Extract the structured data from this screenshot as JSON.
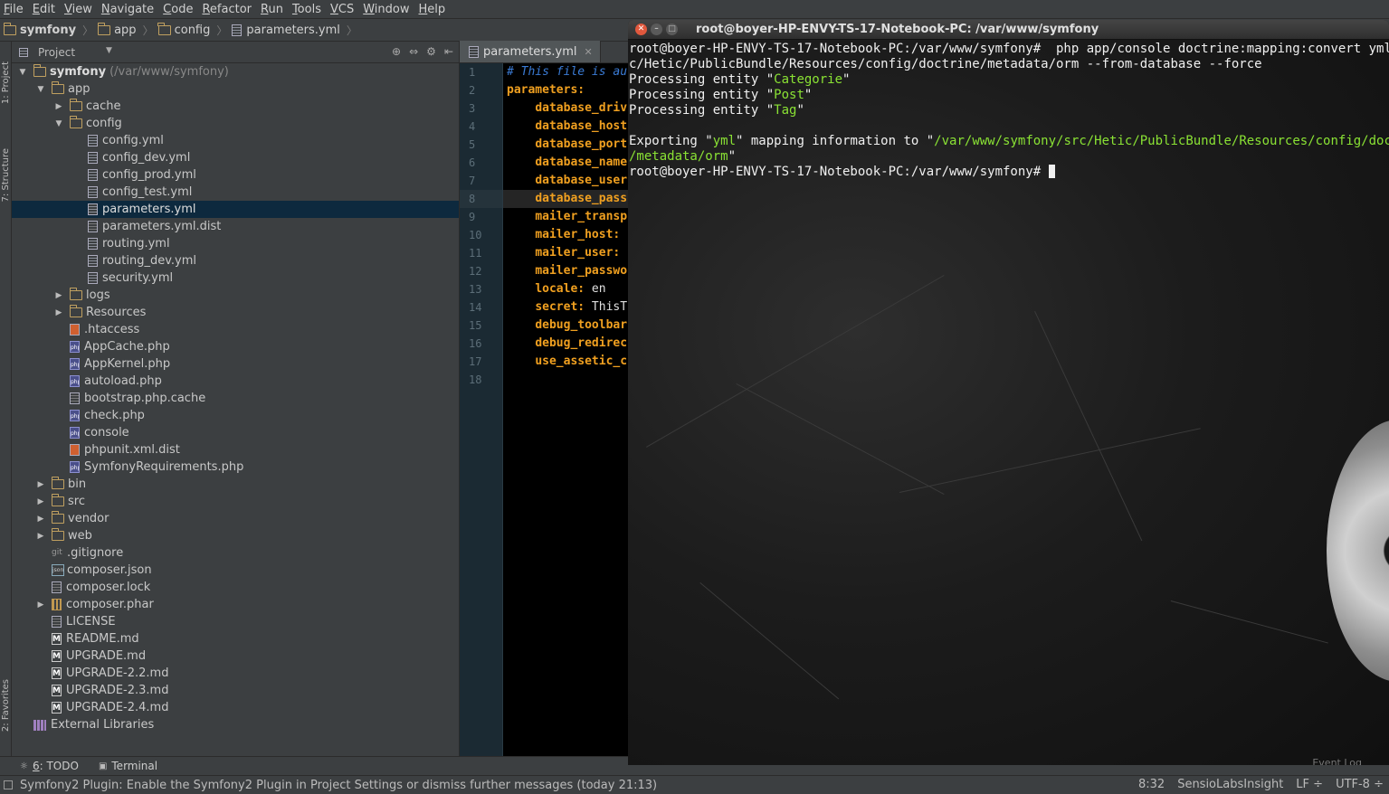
{
  "menu": [
    "File",
    "Edit",
    "View",
    "Navigate",
    "Code",
    "Refactor",
    "Run",
    "Tools",
    "VCS",
    "Window",
    "Help"
  ],
  "breadcrumb": [
    "symfony",
    "app",
    "config",
    "parameters.yml"
  ],
  "left_strip": {
    "project": "1: Project",
    "structure": "7: Structure",
    "favorites": "2: Favorites"
  },
  "project_panel": {
    "title": "Project",
    "tree": [
      {
        "label": "symfony",
        "note": "(/var/www/symfony)",
        "depth": 0,
        "type": "folder",
        "arrow": "▼",
        "bold": true
      },
      {
        "label": "app",
        "depth": 1,
        "type": "folder",
        "arrow": "▼"
      },
      {
        "label": "cache",
        "depth": 2,
        "type": "folder",
        "arrow": "▶"
      },
      {
        "label": "config",
        "depth": 2,
        "type": "folder",
        "arrow": "▼"
      },
      {
        "label": "config.yml",
        "depth": 3,
        "type": "yml"
      },
      {
        "label": "config_dev.yml",
        "depth": 3,
        "type": "yml"
      },
      {
        "label": "config_prod.yml",
        "depth": 3,
        "type": "yml"
      },
      {
        "label": "config_test.yml",
        "depth": 3,
        "type": "yml"
      },
      {
        "label": "parameters.yml",
        "depth": 3,
        "type": "yml",
        "selected": true
      },
      {
        "label": "parameters.yml.dist",
        "depth": 3,
        "type": "txt"
      },
      {
        "label": "routing.yml",
        "depth": 3,
        "type": "yml"
      },
      {
        "label": "routing_dev.yml",
        "depth": 3,
        "type": "yml"
      },
      {
        "label": "security.yml",
        "depth": 3,
        "type": "yml"
      },
      {
        "label": "logs",
        "depth": 2,
        "type": "folder",
        "arrow": "▶"
      },
      {
        "label": "Resources",
        "depth": 2,
        "type": "folder",
        "arrow": "▶"
      },
      {
        "label": ".htaccess",
        "depth": 2,
        "type": "ht"
      },
      {
        "label": "AppCache.php",
        "depth": 2,
        "type": "php"
      },
      {
        "label": "AppKernel.php",
        "depth": 2,
        "type": "php"
      },
      {
        "label": "autoload.php",
        "depth": 2,
        "type": "php"
      },
      {
        "label": "bootstrap.php.cache",
        "depth": 2,
        "type": "txt"
      },
      {
        "label": "check.php",
        "depth": 2,
        "type": "php"
      },
      {
        "label": "console",
        "depth": 2,
        "type": "php"
      },
      {
        "label": "phpunit.xml.dist",
        "depth": 2,
        "type": "ht"
      },
      {
        "label": "SymfonyRequirements.php",
        "depth": 2,
        "type": "php"
      },
      {
        "label": "bin",
        "depth": 1,
        "type": "folder",
        "arrow": "▶"
      },
      {
        "label": "src",
        "depth": 1,
        "type": "folder",
        "arrow": "▶"
      },
      {
        "label": "vendor",
        "depth": 1,
        "type": "folder",
        "arrow": "▶"
      },
      {
        "label": "web",
        "depth": 1,
        "type": "folder",
        "arrow": "▶"
      },
      {
        "label": ".gitignore",
        "depth": 1,
        "type": "git"
      },
      {
        "label": "composer.json",
        "depth": 1,
        "type": "json"
      },
      {
        "label": "composer.lock",
        "depth": 1,
        "type": "txt"
      },
      {
        "label": "composer.phar",
        "depth": 1,
        "type": "phar",
        "arrow": "▶"
      },
      {
        "label": "LICENSE",
        "depth": 1,
        "type": "txt"
      },
      {
        "label": "README.md",
        "depth": 1,
        "type": "md"
      },
      {
        "label": "UPGRADE.md",
        "depth": 1,
        "type": "md"
      },
      {
        "label": "UPGRADE-2.2.md",
        "depth": 1,
        "type": "md"
      },
      {
        "label": "UPGRADE-2.3.md",
        "depth": 1,
        "type": "md"
      },
      {
        "label": "UPGRADE-2.4.md",
        "depth": 1,
        "type": "md"
      },
      {
        "label": "External Libraries",
        "depth": 0,
        "type": "lib"
      }
    ]
  },
  "editor": {
    "tab": "parameters.yml",
    "current_line": 8,
    "lines": [
      {
        "n": "1",
        "parts": [
          {
            "c": "cm",
            "t": "# This file is au"
          }
        ]
      },
      {
        "n": "2",
        "parts": [
          {
            "c": "ky",
            "t": "parameters:"
          }
        ]
      },
      {
        "n": "3",
        "parts": [
          {
            "c": "vl",
            "t": "    "
          },
          {
            "c": "ky",
            "t": "database_driv"
          }
        ]
      },
      {
        "n": "4",
        "parts": [
          {
            "c": "vl",
            "t": "    "
          },
          {
            "c": "ky",
            "t": "database_host"
          }
        ]
      },
      {
        "n": "5",
        "parts": [
          {
            "c": "vl",
            "t": "    "
          },
          {
            "c": "ky",
            "t": "database_port"
          }
        ]
      },
      {
        "n": "6",
        "parts": [
          {
            "c": "vl",
            "t": "    "
          },
          {
            "c": "ky",
            "t": "database_name"
          }
        ]
      },
      {
        "n": "7",
        "parts": [
          {
            "c": "vl",
            "t": "    "
          },
          {
            "c": "ky",
            "t": "database_user"
          }
        ]
      },
      {
        "n": "8",
        "parts": [
          {
            "c": "vl",
            "t": "    "
          },
          {
            "c": "ky",
            "t": "database_pass"
          }
        ]
      },
      {
        "n": "9",
        "parts": [
          {
            "c": "vl",
            "t": "    "
          },
          {
            "c": "ky",
            "t": "mailer_transp"
          }
        ]
      },
      {
        "n": "10",
        "parts": [
          {
            "c": "vl",
            "t": "    "
          },
          {
            "c": "ky",
            "t": "mailer_host:"
          }
        ]
      },
      {
        "n": "11",
        "parts": [
          {
            "c": "vl",
            "t": "    "
          },
          {
            "c": "ky",
            "t": "mailer_user:"
          }
        ]
      },
      {
        "n": "12",
        "parts": [
          {
            "c": "vl",
            "t": "    "
          },
          {
            "c": "ky",
            "t": "mailer_passwo"
          }
        ]
      },
      {
        "n": "13",
        "parts": [
          {
            "c": "vl",
            "t": "    "
          },
          {
            "c": "ky",
            "t": "locale:"
          },
          {
            "c": "vl",
            "t": " en"
          }
        ]
      },
      {
        "n": "14",
        "parts": [
          {
            "c": "vl",
            "t": "    "
          },
          {
            "c": "ky",
            "t": "secret:"
          },
          {
            "c": "vl",
            "t": " ThisT"
          }
        ]
      },
      {
        "n": "15",
        "parts": [
          {
            "c": "vl",
            "t": "    "
          },
          {
            "c": "ky",
            "t": "debug_toolbar"
          }
        ]
      },
      {
        "n": "16",
        "parts": [
          {
            "c": "vl",
            "t": "    "
          },
          {
            "c": "ky",
            "t": "debug_redirec"
          }
        ]
      },
      {
        "n": "17",
        "parts": [
          {
            "c": "vl",
            "t": "    "
          },
          {
            "c": "ky",
            "t": "use_assetic_c"
          }
        ]
      },
      {
        "n": "18",
        "parts": []
      }
    ]
  },
  "bottom_tabs": [
    {
      "num": "6",
      "label": ": TODO"
    },
    {
      "num": "",
      "label": "Terminal"
    }
  ],
  "status": {
    "message": "Symfony2 Plugin: Enable the Symfony2 Plugin in Project Settings or dismiss further messages (today 21:13)",
    "position": "8:32",
    "insight": "SensioLabsInsight",
    "line_sep": "LF",
    "encoding": "UTF-8"
  },
  "terminal": {
    "title": "root@boyer-HP-ENVY-TS-17-Notebook-PC: /var/www/symfony",
    "event_log": "Event Log",
    "lines": [
      [
        {
          "c": "",
          "t": "root@boyer-HP-ENVY-TS-17-Notebook-PC:/var/www/symfony#  php app/console doctrine:mapping:convert yml ./sr"
        }
      ],
      [
        {
          "c": "",
          "t": "c/Hetic/PublicBundle/Resources/config/doctrine/metadata/orm --from-database --force"
        }
      ],
      [
        {
          "c": "",
          "t": "Processing entity \""
        },
        {
          "c": "tg",
          "t": "Categorie"
        },
        {
          "c": "",
          "t": "\""
        }
      ],
      [
        {
          "c": "",
          "t": "Processing entity \""
        },
        {
          "c": "tg",
          "t": "Post"
        },
        {
          "c": "",
          "t": "\""
        }
      ],
      [
        {
          "c": "",
          "t": "Processing entity \""
        },
        {
          "c": "tg",
          "t": "Tag"
        },
        {
          "c": "",
          "t": "\""
        }
      ],
      [],
      [
        {
          "c": "",
          "t": "Exporting \""
        },
        {
          "c": "tg",
          "t": "yml"
        },
        {
          "c": "",
          "t": "\" mapping information to \""
        },
        {
          "c": "tg",
          "t": "/var/www/symfony/src/Hetic/PublicBundle/Resources/config/doctrine"
        }
      ],
      [
        {
          "c": "tg",
          "t": "/metadata/orm"
        },
        {
          "c": "",
          "t": "\""
        }
      ],
      [
        {
          "c": "",
          "t": "root@boyer-HP-ENVY-TS-17-Notebook-PC:/var/www/symfony# "
        },
        {
          "c": "cursor",
          "t": ""
        }
      ]
    ]
  }
}
